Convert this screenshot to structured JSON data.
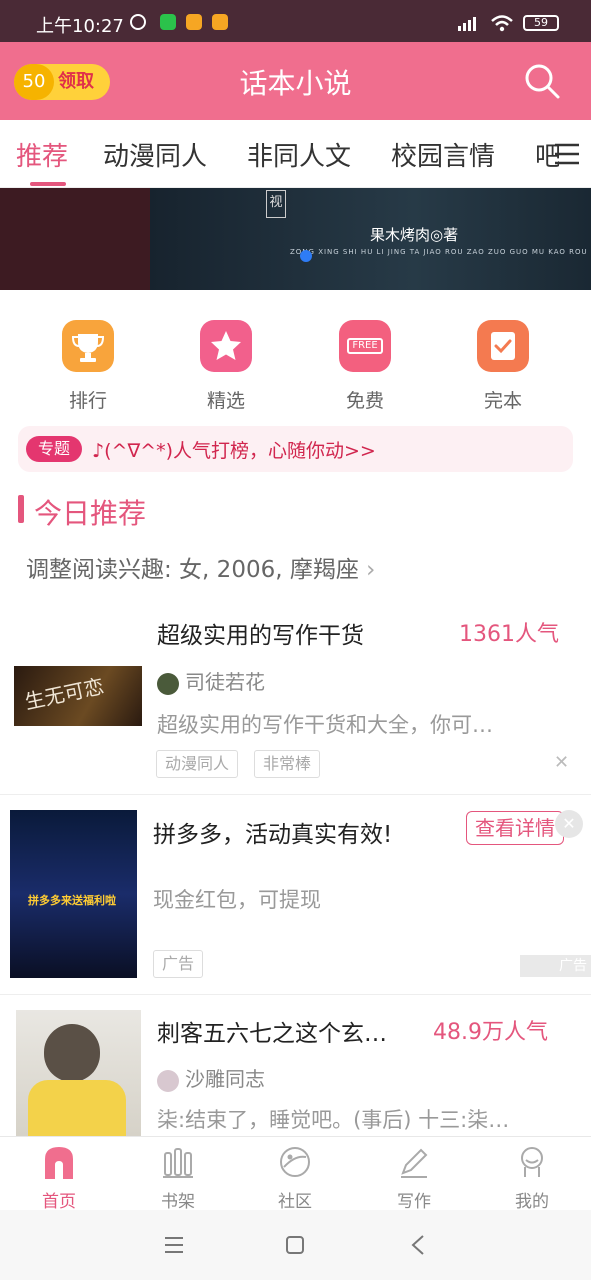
{
  "status_bar": {
    "time": "上午10:27",
    "battery": "59"
  },
  "header": {
    "coin_amount": "50",
    "coin_label": "领取",
    "title": "话本小说"
  },
  "tabs": [
    {
      "label": "推荐",
      "active": true
    },
    {
      "label": "动漫同人"
    },
    {
      "label": "非同人文"
    },
    {
      "label": "校园言情"
    },
    {
      "label": "吧"
    }
  ],
  "banner": {
    "author": "果木烤肉◎著",
    "subtitle": "ZONG XING SHI HU LI JING TA JIAO ROU ZAO ZUO GUO MU KAO ROU ZHU",
    "art_text": "视"
  },
  "quick_entries": [
    {
      "label": "排行",
      "icon": "trophy-icon",
      "color": "#f8a43c"
    },
    {
      "label": "精选",
      "icon": "star-icon",
      "color": "#f2608c"
    },
    {
      "label": "免费",
      "icon": "free-icon",
      "color": "#f3607f",
      "icon_text": "FREE"
    },
    {
      "label": "完本",
      "icon": "check-book-icon",
      "color": "#f47a50"
    }
  ],
  "topic": {
    "badge": "专题",
    "text": "♪(^∇^*)人气打榜，心随你动>>"
  },
  "today": {
    "title": "今日推荐",
    "interest": "调整阅读兴趣: 女, 2006, 摩羯座"
  },
  "cards": [
    {
      "title": "超级实用的写作干货",
      "hot": "1361人气",
      "author": "司徒若花",
      "desc": "超级实用的写作干货和大全，你可…",
      "tags": [
        "动漫同人",
        "非常棒"
      ],
      "cover_text": "生无可恋"
    },
    {
      "title": "刺客五六七之这个玄…",
      "hot": "48.9万人气",
      "author": "沙雕同志",
      "desc": "柒:结束了，睡觉吧。(事后) 十三:柒…"
    }
  ],
  "ad": {
    "title": "拼多多，活动真实有效!",
    "button": "查看详情",
    "desc": "现金红包，可提现",
    "tag": "广告",
    "corner": "广告",
    "cover_text": "拼多多来送福利啦"
  },
  "bottom_nav": [
    {
      "label": "首页",
      "icon": "home-icon",
      "active": true
    },
    {
      "label": "书架",
      "icon": "bookshelf-icon"
    },
    {
      "label": "社区",
      "icon": "community-icon"
    },
    {
      "label": "写作",
      "icon": "pen-icon"
    },
    {
      "label": "我的",
      "icon": "profile-icon"
    }
  ],
  "colors": {
    "brand": "#f06e8e",
    "accent": "#e4567d"
  }
}
